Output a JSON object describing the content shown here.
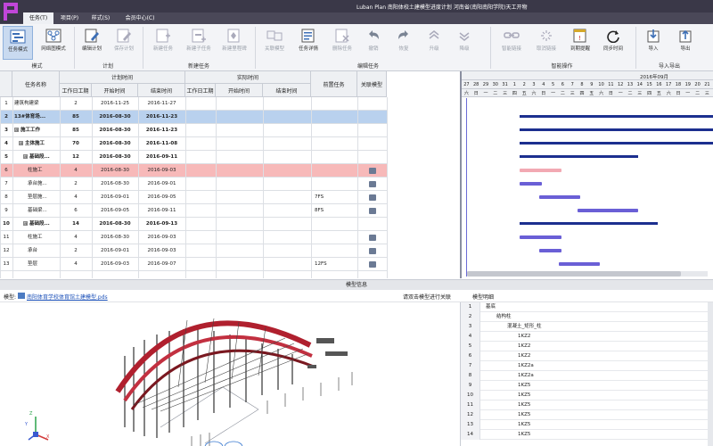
{
  "app": {
    "title": "Luban Plan 南阳体校土建模型进度计划 河南省(南阳南阳学院)天工开物",
    "logo_icon": "luban-logo"
  },
  "menu": [
    "任务(T)",
    "项目(P)",
    "样式(S)",
    "会员中心(C)"
  ],
  "ribbon": {
    "buttons": [
      {
        "label": "任务模式",
        "icon": "task-mode-icon",
        "state": "active"
      },
      {
        "label": "网络图模式",
        "icon": "network-mode-icon",
        "state": "normal"
      },
      {
        "label": "编辑计划",
        "icon": "edit-plan-icon",
        "state": "normal"
      },
      {
        "label": "保存计划",
        "icon": "save-plan-icon",
        "state": "disabled"
      },
      {
        "label": "新建任务",
        "icon": "new-task-icon",
        "state": "disabled"
      },
      {
        "label": "新建子任务",
        "icon": "new-subtask-icon",
        "state": "disabled"
      },
      {
        "label": "新建里程碑",
        "icon": "new-milestone-icon",
        "state": "disabled"
      },
      {
        "label": "关联模型",
        "icon": "link-model-icon",
        "state": "disabled"
      },
      {
        "label": "任务详情",
        "icon": "task-detail-icon",
        "state": "normal"
      },
      {
        "label": "删除任务",
        "icon": "delete-task-icon",
        "state": "disabled"
      },
      {
        "label": "撤销",
        "icon": "undo-icon",
        "state": "disabled"
      },
      {
        "label": "恢复",
        "icon": "redo-icon",
        "state": "disabled"
      },
      {
        "label": "升级",
        "icon": "upgrade-icon",
        "state": "disabled"
      },
      {
        "label": "降级",
        "icon": "downgrade-icon",
        "state": "disabled"
      },
      {
        "label": "智能链接",
        "icon": "smart-link-icon",
        "state": "disabled"
      },
      {
        "label": "取消链接",
        "icon": "unlink-icon",
        "state": "disabled"
      },
      {
        "label": "到期提醒",
        "icon": "due-reminder-icon",
        "state": "normal"
      },
      {
        "label": "同步时间",
        "icon": "sync-time-icon",
        "state": "normal"
      },
      {
        "label": "导入",
        "icon": "import-icon",
        "state": "normal"
      },
      {
        "label": "导出",
        "icon": "export-icon",
        "state": "normal"
      }
    ],
    "groups": [
      "模式",
      "计划",
      "新建任务",
      "编辑任务",
      "智能操作",
      "导入导出"
    ]
  },
  "grid": {
    "headers": {
      "task_name": "任务名称",
      "plan_time": "计划时间",
      "actual_time": "实际时间",
      "duration": "工作日工期",
      "start": "开始时间",
      "end": "结束时间",
      "predecessor": "前置任务",
      "linked_model": "关联模型"
    },
    "rows": [
      {
        "no": "1",
        "name": "建筑构建梁",
        "dur": "2",
        "start": "2016-11-25",
        "end": "2016-11-27",
        "pred": "",
        "bold": false,
        "indent": 0,
        "expander": "",
        "link": false
      },
      {
        "no": "2",
        "name": "13#体育场...",
        "dur": "85",
        "start": "2016-08-30",
        "end": "2016-11-23",
        "pred": "",
        "bold": true,
        "indent": 0,
        "expander": "",
        "link": false
      },
      {
        "no": "3",
        "name": "施工工作",
        "dur": "85",
        "start": "2016-08-30",
        "end": "2016-11-23",
        "pred": "",
        "bold": true,
        "indent": 0,
        "expander": "⊟",
        "link": false
      },
      {
        "no": "4",
        "name": "主体施工",
        "dur": "70",
        "start": "2016-08-30",
        "end": "2016-11-08",
        "pred": "",
        "bold": true,
        "indent": 1,
        "expander": "⊟",
        "link": false
      },
      {
        "no": "5",
        "name": "基础段...",
        "dur": "12",
        "start": "2016-08-30",
        "end": "2016-09-11",
        "pred": "",
        "bold": true,
        "indent": 2,
        "expander": "⊟",
        "link": false
      },
      {
        "no": "6",
        "name": "柱施工",
        "dur": "4",
        "start": "2016-08-30",
        "end": "2016-09-03",
        "pred": "",
        "bold": false,
        "indent": 3,
        "expander": "",
        "link": true
      },
      {
        "no": "7",
        "name": "承台施...",
        "dur": "2",
        "start": "2016-08-30",
        "end": "2016-09-01",
        "pred": "",
        "bold": false,
        "indent": 3,
        "expander": "",
        "link": true
      },
      {
        "no": "8",
        "name": "垫层施...",
        "dur": "4",
        "start": "2016-09-01",
        "end": "2016-09-05",
        "pred": "7FS",
        "bold": false,
        "indent": 3,
        "expander": "",
        "link": true
      },
      {
        "no": "9",
        "name": "基础梁...",
        "dur": "6",
        "start": "2016-09-05",
        "end": "2016-09-11",
        "pred": "8FS",
        "bold": false,
        "indent": 3,
        "expander": "",
        "link": true
      },
      {
        "no": "10",
        "name": "基础段...",
        "dur": "14",
        "start": "2016-08-30",
        "end": "2016-09-13",
        "pred": "",
        "bold": true,
        "indent": 2,
        "expander": "⊟",
        "link": false
      },
      {
        "no": "11",
        "name": "柱施工",
        "dur": "4",
        "start": "2016-08-30",
        "end": "2016-09-03",
        "pred": "",
        "bold": false,
        "indent": 3,
        "expander": "",
        "link": true
      },
      {
        "no": "12",
        "name": "承台",
        "dur": "2",
        "start": "2016-09-01",
        "end": "2016-09-03",
        "pred": "",
        "bold": false,
        "indent": 3,
        "expander": "",
        "link": true
      },
      {
        "no": "13",
        "name": "垫层",
        "dur": "4",
        "start": "2016-09-03",
        "end": "2016-09-07",
        "pred": "12FS",
        "bold": false,
        "indent": 3,
        "expander": "",
        "link": true
      }
    ]
  },
  "gantt": {
    "month_label": "2016年09月",
    "days": [
      "27",
      "28",
      "29",
      "30",
      "31",
      "1",
      "2",
      "3",
      "4",
      "5",
      "6",
      "7",
      "8",
      "9",
      "10",
      "11",
      "12",
      "13",
      "14",
      "15",
      "16",
      "17",
      "18",
      "19",
      "20",
      "21"
    ],
    "weekdays": [
      "六",
      "日",
      "一",
      "二",
      "三",
      "四",
      "五",
      "六",
      "日",
      "一",
      "二",
      "三",
      "四",
      "五",
      "六",
      "日",
      "一",
      "二",
      "三",
      "四",
      "五",
      "六",
      "日",
      "一",
      "二",
      "三"
    ]
  },
  "model": {
    "panel_title": "模型信息",
    "file_label": "模型:",
    "file_name": "南阳体育学校体育馆土建模型.pds",
    "hint": "请双击模型进行关联",
    "detail_label": "模型明细",
    "axis_labels": [
      "Z",
      "Y",
      "X"
    ]
  },
  "properties": [
    {
      "no": "1",
      "value": "基底",
      "level": 0
    },
    {
      "no": "2",
      "value": "结构柱",
      "level": 1
    },
    {
      "no": "3",
      "value": "混凝土_矩形_柱",
      "level": 2
    },
    {
      "no": "4",
      "value": "1KZ2",
      "level": 3
    },
    {
      "no": "5",
      "value": "1KZ2",
      "level": 3
    },
    {
      "no": "6",
      "value": "1KZ2",
      "level": 3
    },
    {
      "no": "7",
      "value": "1KZ2a",
      "level": 3
    },
    {
      "no": "8",
      "value": "1KZ2a",
      "level": 3
    },
    {
      "no": "9",
      "value": "1KZ5",
      "level": 3
    },
    {
      "no": "10",
      "value": "1KZ5",
      "level": 3
    },
    {
      "no": "11",
      "value": "1KZ5",
      "level": 3
    },
    {
      "no": "12",
      "value": "1KZ5",
      "level": 3
    },
    {
      "no": "13",
      "value": "1KZ5",
      "level": 3
    },
    {
      "no": "14",
      "value": "1KZ5",
      "level": 3
    }
  ],
  "colors": {
    "titlebar": "#3a3848",
    "selected_row": "#b9d1ee",
    "highlight_row": "#f7b9b9",
    "summary_bar": "#1c2f8f",
    "task_bar": "#6a5fd6",
    "critical_bar": "#f2a9b3"
  }
}
